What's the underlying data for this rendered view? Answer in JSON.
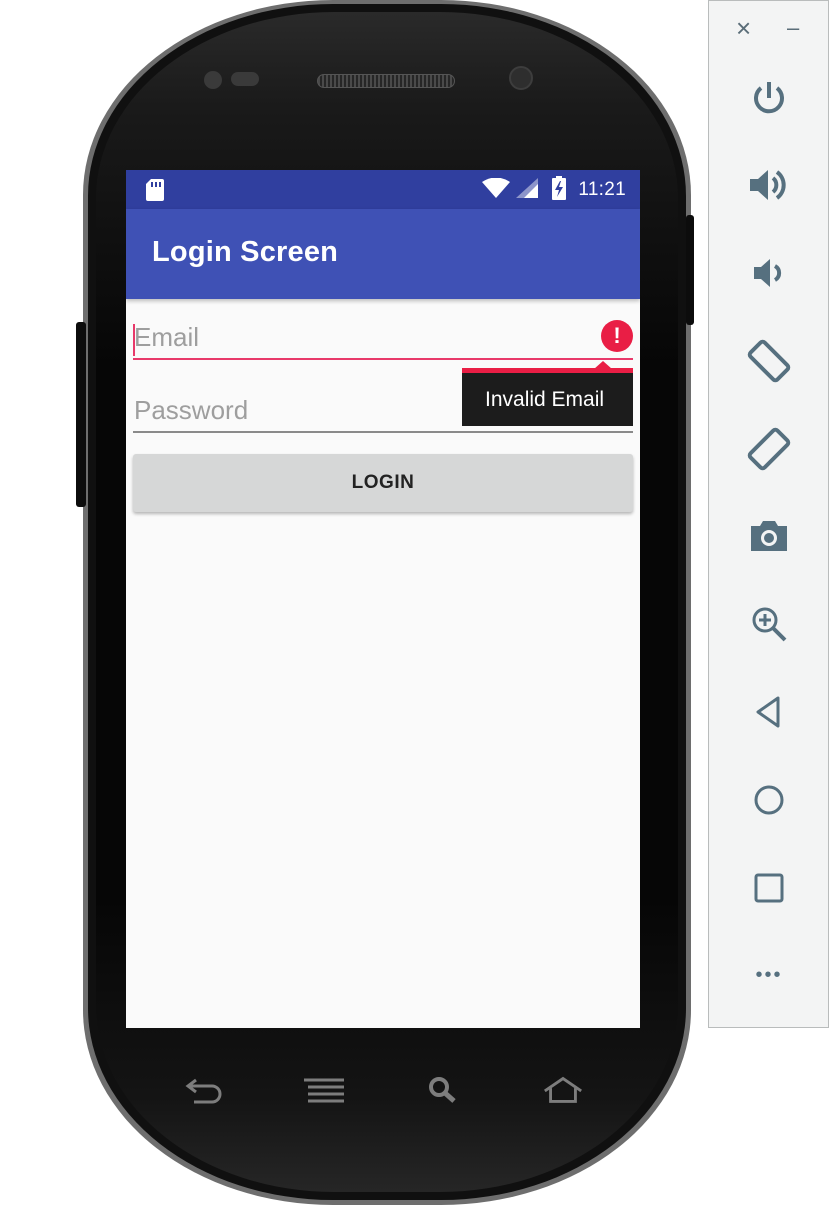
{
  "status_bar": {
    "time": "11:21"
  },
  "app_bar": {
    "title": "Login Screen"
  },
  "form": {
    "email_placeholder": "Email",
    "password_placeholder": "Password",
    "error_tooltip": "Invalid Email",
    "error_icon_glyph": "!",
    "login_label": "LOGIN"
  },
  "emulator_panel": {
    "close_glyph": "×",
    "minimize_glyph": "–",
    "more_glyph": "•••",
    "buttons": [
      "power",
      "volume-up",
      "volume-down",
      "rotate-left",
      "rotate-right",
      "screenshot",
      "zoom",
      "back",
      "home",
      "overview",
      "more"
    ]
  },
  "colors": {
    "primary": "#3f51b5",
    "primary_dark": "#303f9f",
    "accent_error": "#e91e45",
    "panel_icon": "#56707f"
  }
}
